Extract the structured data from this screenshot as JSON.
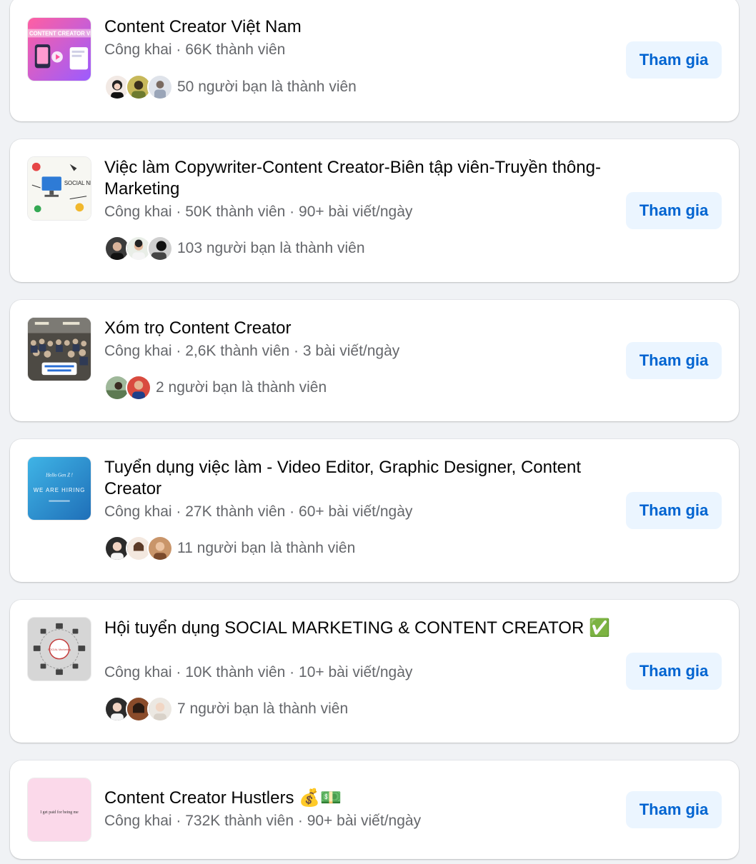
{
  "groups": [
    {
      "name": "Content Creator Việt Nam",
      "privacy": "Công khai",
      "members": "66K thành viên",
      "posts": "",
      "friends": "50 người bạn là thành viên",
      "join_label": "Tham gia",
      "thumb_text": "CONTENT CREATOR VIỆT NAM",
      "thumb_icon": "content-creator-vietnam-thumbnail"
    },
    {
      "name": "Việc làm Copywriter-Content Creator-Biên tập viên-Truyền thông-Marketing",
      "privacy": "Công khai",
      "members": "50K thành viên",
      "posts": "90+ bài viết/ngày",
      "friends": "103 người bạn là thành viên",
      "join_label": "Tham gia",
      "thumb_text": "SOCIAL NETWORK",
      "thumb_icon": "social-network-doodle-thumbnail"
    },
    {
      "name": "Xóm trọ Content Creator",
      "privacy": "Công khai",
      "members": "2,6K thành viên",
      "posts": "3 bài viết/ngày",
      "friends": "2 người bạn là thành viên",
      "join_label": "Tham gia",
      "thumb_icon": "event-crowd-photo-thumbnail"
    },
    {
      "name": "Tuyển dụng việc làm - Video Editor, Graphic Designer, Content Creator",
      "privacy": "Công khai",
      "members": "27K thành viên",
      "posts": "60+ bài viết/ngày",
      "friends": "11 người bạn là thành viên",
      "join_label": "Tham gia",
      "thumb_text_top": "Hello Gen Z !",
      "thumb_text": "WE ARE HIRING",
      "thumb_icon": "we-are-hiring-thumbnail"
    },
    {
      "name": "Hội tuyển dụng SOCIAL MARKETING & CONTENT CREATOR ✅",
      "privacy": "Công khai",
      "members": "10K thành viên",
      "posts": "10+ bài viết/ngày",
      "friends": "7 người bạn là thành viên",
      "join_label": "Tham gia",
      "thumb_text": "SOCIAL Marketing",
      "thumb_icon": "social-marketing-diagram-thumbnail"
    },
    {
      "name": "Content Creator Hustlers 💰💵",
      "privacy": "Công khai",
      "members": "732K thành viên",
      "posts": "90+ bài viết/ngày",
      "friends": "",
      "join_label": "Tham gia",
      "thumb_text": "I get paid for being me",
      "thumb_icon": "pink-quote-thumbnail"
    }
  ],
  "separator": " · ",
  "colors": {
    "background": "#f0f2f5",
    "card": "#ffffff",
    "join_bg": "#ebf5ff",
    "join_text": "#0064d1",
    "meta_text": "#65676b"
  }
}
